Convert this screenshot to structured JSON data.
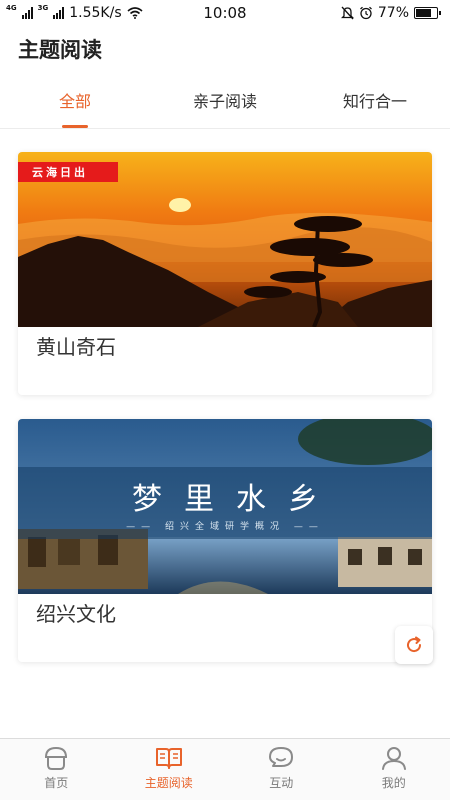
{
  "status_bar": {
    "net_tag_1": "4G",
    "net_tag_2": "3G",
    "speed": "1.55K/s",
    "time": "10:08",
    "battery": "77%",
    "battery_level": 0.77,
    "icons": [
      "signal-icon",
      "wifi-icon",
      "mute-icon",
      "alarm-icon",
      "battery-icon"
    ]
  },
  "header": {
    "title": "主题阅读"
  },
  "tabs": [
    {
      "label": "全部",
      "active": true
    },
    {
      "label": "亲子阅读",
      "active": false
    },
    {
      "label": "知行合一",
      "active": false
    }
  ],
  "cards": [
    {
      "badge": "云海日出",
      "title": "黄山奇石"
    },
    {
      "banner_title": "梦里水乡",
      "banner_subtitle": "—— 绍兴全域研学概况 ——",
      "title": "绍兴文化"
    }
  ],
  "colors": {
    "accent": "#e8632b",
    "badge": "#e51b1b"
  },
  "bottom_nav": [
    {
      "label": "首页",
      "icon": "home-icon",
      "active": false
    },
    {
      "label": "主题阅读",
      "icon": "book-icon",
      "active": true
    },
    {
      "label": "互动",
      "icon": "chat-icon",
      "active": false
    },
    {
      "label": "我的",
      "icon": "user-icon",
      "active": false
    }
  ]
}
